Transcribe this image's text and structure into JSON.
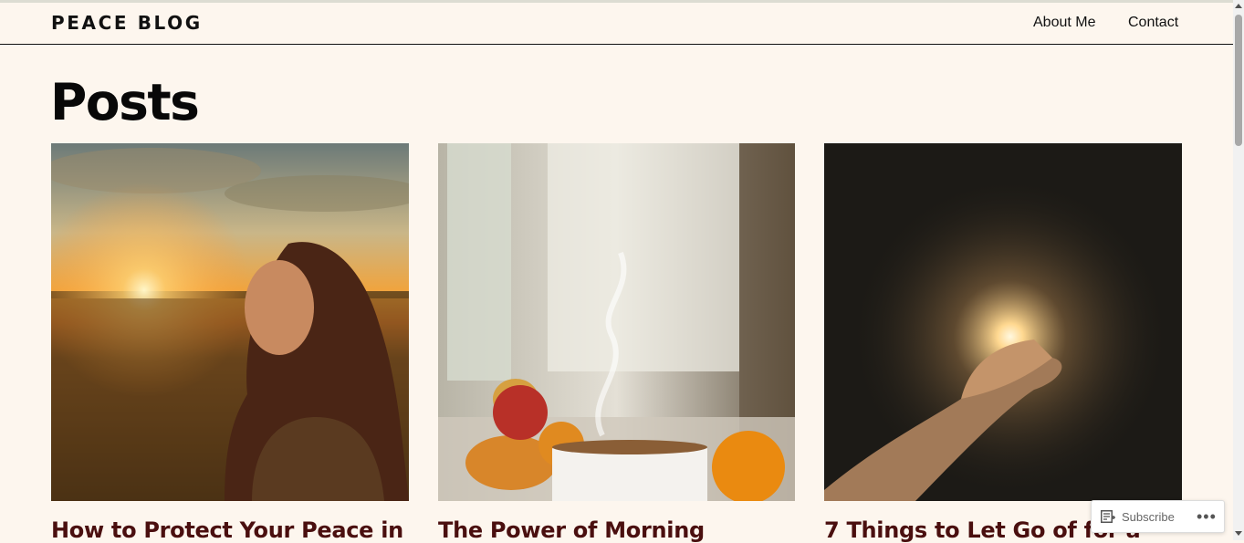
{
  "header": {
    "site_title": "PEACE BLOG",
    "nav": [
      {
        "label": "About Me"
      },
      {
        "label": "Contact"
      }
    ]
  },
  "main": {
    "page_title": "Posts",
    "posts": [
      {
        "title": "How to Protect Your Peace in",
        "image": "woman-sunset-field"
      },
      {
        "title": "The Power of Morning",
        "image": "morning-coffee-window"
      },
      {
        "title": "7 Things to Let Go of for a",
        "image": "hand-light-burst"
      }
    ]
  },
  "subscribe_bar": {
    "subscribe_label": "Subscribe",
    "more_label": "•••"
  },
  "colors": {
    "background": "#fdf6ee",
    "post_title": "#4a0f0f",
    "text": "#111111"
  }
}
